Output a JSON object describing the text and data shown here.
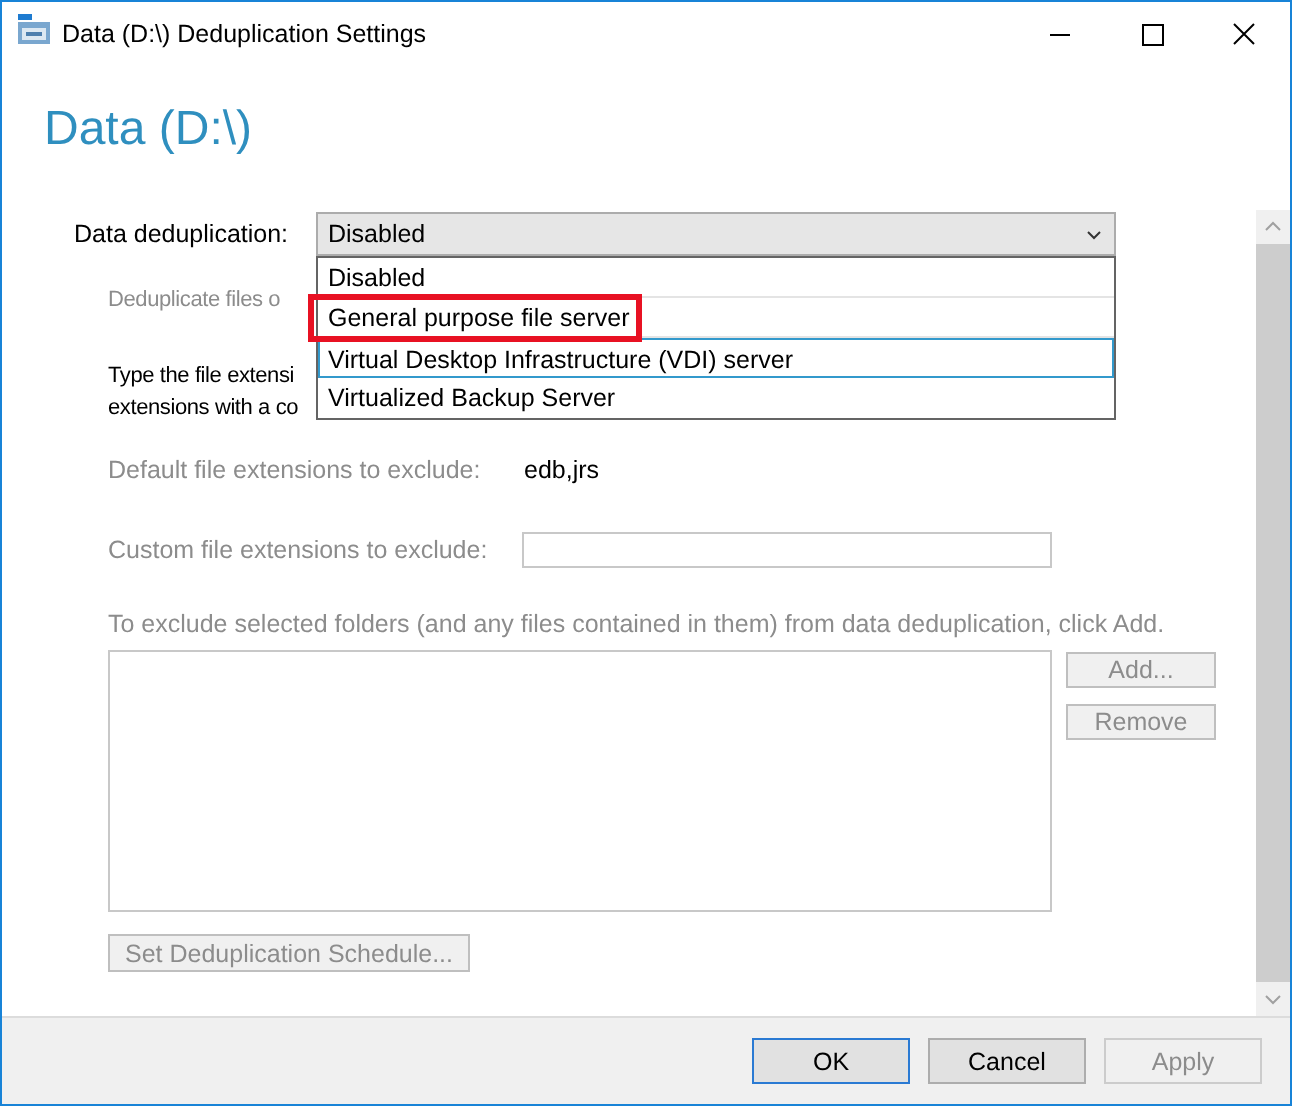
{
  "window": {
    "title": "Data (D:\\) Deduplication Settings"
  },
  "heading": "Data (D:\\)",
  "deduplication": {
    "label": "Data deduplication:",
    "value": "Disabled",
    "expanded": true,
    "options": [
      {
        "label": "Disabled",
        "focused": false,
        "annotated": false
      },
      {
        "label": "General purpose file server",
        "focused": false,
        "annotated": true
      },
      {
        "label": "Virtual Desktop Infrastructure (VDI) server",
        "focused": true,
        "annotated": false
      },
      {
        "label": "Virtualized Backup Server",
        "focused": false,
        "annotated": false
      }
    ]
  },
  "covered_texts": [
    {
      "text": "Deduplicate files o",
      "disabled": true
    },
    {
      "text": "Type the file extensi",
      "disabled": false
    },
    {
      "text": "extensions with a co",
      "disabled": false
    }
  ],
  "default_extensions": {
    "label": "Default file extensions to exclude:",
    "value": "edb,jrs",
    "disabled": true
  },
  "custom_extensions": {
    "label": "Custom file extensions to exclude:",
    "disabled": true
  },
  "folders": {
    "instruction": "To exclude selected folders (and any files contained in them) from data deduplication, click Add.",
    "disabled": true,
    "buttons": [
      {
        "label": "Add...",
        "disabled": true
      },
      {
        "label": "Remove",
        "disabled": true
      }
    ]
  },
  "schedule_button": {
    "label": "Set Deduplication Schedule...",
    "disabled": true
  },
  "footer_buttons": [
    {
      "label": "OK",
      "default": true,
      "disabled": false
    },
    {
      "label": "Cancel",
      "default": false,
      "disabled": false
    },
    {
      "label": "Apply",
      "default": false,
      "disabled": true
    }
  ]
}
